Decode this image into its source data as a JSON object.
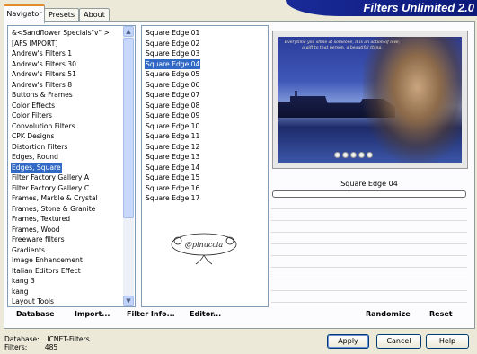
{
  "tabs": [
    {
      "label": "Navigator"
    },
    {
      "label": "Presets"
    },
    {
      "label": "About"
    }
  ],
  "banner": {
    "title": "Filters Unlimited 2.0"
  },
  "categories": [
    "&<Sandflower Specials\"v\" >",
    "[AFS IMPORT]",
    "Andrew's Filters 1",
    "Andrew's Filters 30",
    "Andrew's Filters 51",
    "Andrew's Filters 8",
    "Buttons & Frames",
    "Color Effects",
    "Color Filters",
    "Convolution Filters",
    "CPK Designs",
    "Distortion Filters",
    "Edges, Round",
    "Edges, Square",
    "Filter Factory Gallery A",
    "Filter Factory Gallery C",
    "Frames, Marble & Crystal",
    "Frames, Stone & Granite",
    "Frames, Textured",
    "Frames, Wood",
    "Freeware filters",
    "Gradients",
    "Image Enhancement",
    "Italian Editors Effect",
    "kang 3",
    "kang",
    "Layout Tools"
  ],
  "selected_category": "Edges, Square",
  "filters": [
    "Square Edge 01",
    "Square Edge 02",
    "Square Edge 03",
    "Square Edge 04",
    "Square Edge 05",
    "Square Edge 06",
    "Square Edge 07",
    "Square Edge 08",
    "Square Edge 09",
    "Square Edge 10",
    "Square Edge 11",
    "Square Edge 12",
    "Square Edge 13",
    "Square Edge 14",
    "Square Edge 15",
    "Square Edge 16",
    "Square Edge 17"
  ],
  "selected_filter": "Square Edge 04",
  "preview": {
    "filter_name": "Square Edge 04",
    "image_text": "Everytime you smile at someone, it is an action of love, a gift to that person, a beautiful thing."
  },
  "watermark": {
    "text": "@pinuccia"
  },
  "toolbar": {
    "database": "Database",
    "import": "Import...",
    "filter_info": "Filter Info...",
    "editor": "Editor...",
    "randomize": "Randomize",
    "reset": "Reset"
  },
  "status": {
    "database_label": "Database:",
    "database_value": "ICNET-Filters",
    "filters_label": "Filters:",
    "filters_value": "485"
  },
  "buttons": {
    "apply": "Apply",
    "cancel": "Cancel",
    "help": "Help"
  },
  "colors": {
    "selection": "#316ac5",
    "banner": "#1a2a98",
    "tab_accent": "#e68b2c"
  }
}
